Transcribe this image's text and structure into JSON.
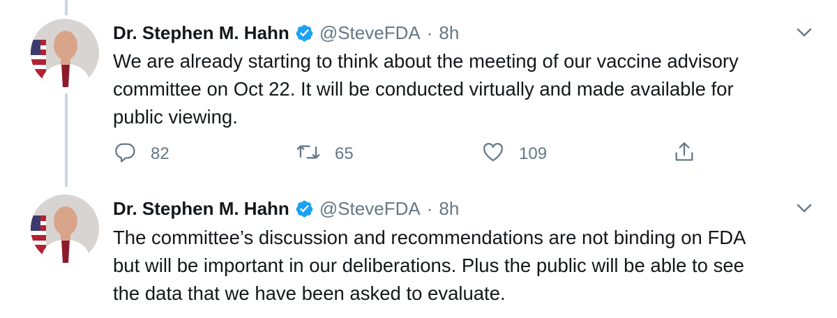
{
  "tweets": [
    {
      "author_name": "Dr. Stephen M. Hahn",
      "handle": "@SteveFDA",
      "separator": "·",
      "time": "8h",
      "text": "We are already starting to think about the meeting of our vaccine advisory\ncommittee on Oct 22.  It will be conducted virtually and made available for\npublic viewing.",
      "replies": "82",
      "retweets": "65",
      "likes": "109"
    },
    {
      "author_name": "Dr. Stephen M. Hahn",
      "handle": "@SteveFDA",
      "separator": "·",
      "time": "8h",
      "text": "The committee’s discussion and recommendations are not binding on FDA\nbut will be important in our deliberations.  Plus the public will be able to see\nthe data that we have been asked to evaluate."
    }
  ],
  "colors": {
    "text": "#14171a",
    "secondary": "#657786",
    "verified": "#1da1f2",
    "thread_line": "#ccd6dd"
  },
  "icons": [
    "verified-badge-icon",
    "chevron-down-icon",
    "reply-icon",
    "retweet-icon",
    "like-icon",
    "share-icon"
  ]
}
